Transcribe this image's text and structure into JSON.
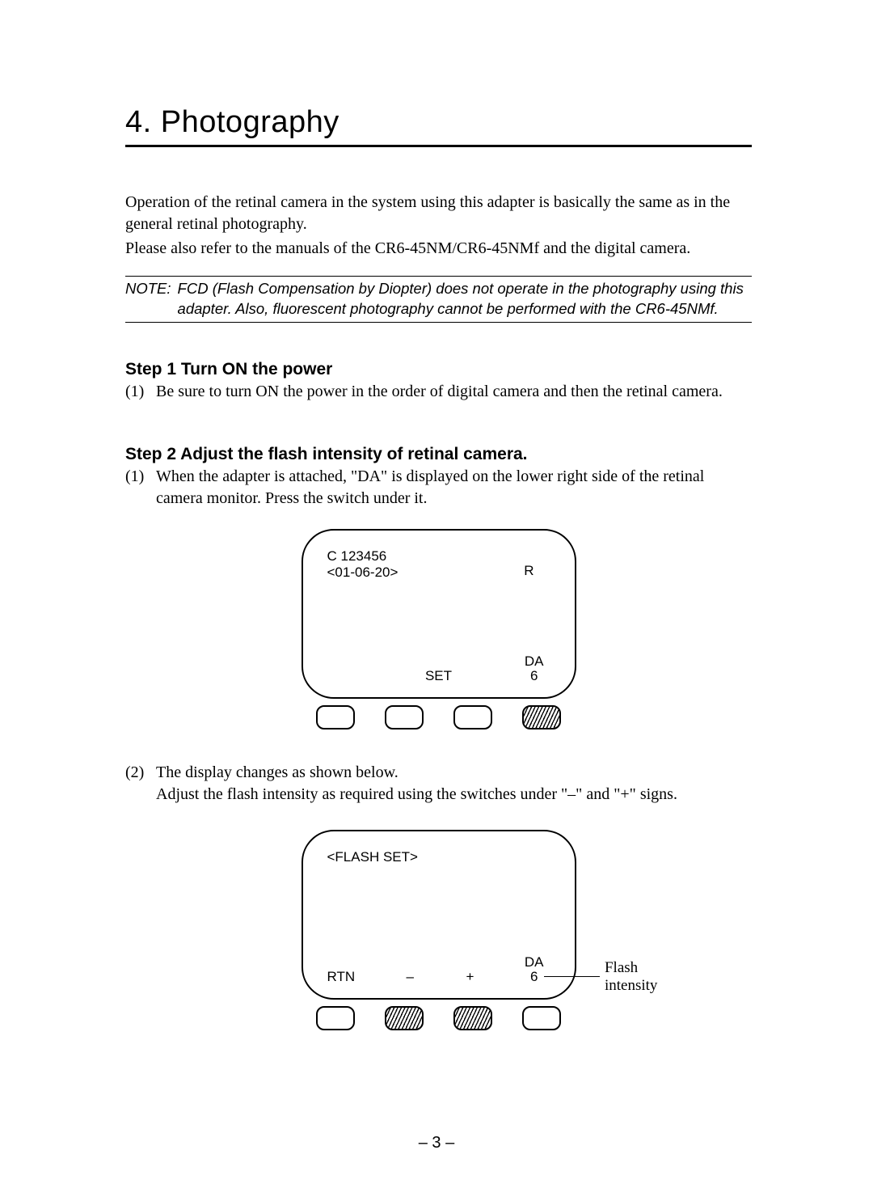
{
  "chapter": {
    "number": "4.",
    "title": "Photography"
  },
  "intro": {
    "p1": "Operation of the retinal camera in the system using this adapter is basically the same as in the general retinal photography.",
    "p2": "Please also refer to the manuals of the CR6-45NM/CR6-45NMf and the digital camera."
  },
  "note": {
    "label": "NOTE:",
    "text": "FCD (Flash Compensation by Diopter) does not operate in the photography using this adapter. Also, fluorescent photography cannot be performed with the CR6-45NMf."
  },
  "step1": {
    "heading": "Step 1  Turn ON the power",
    "item1_num": "(1)",
    "item1_text": "Be sure to turn ON the power in the order of digital camera and then the retinal camera."
  },
  "step2": {
    "heading": "Step 2  Adjust the flash intensity of retinal camera.",
    "item1_num": "(1)",
    "item1_text": "When the adapter is attached, \"DA\" is displayed on the lower right side of the retinal camera monitor. Press the switch under it.",
    "item2_num": "(2)",
    "item2_text_a": "The display changes as shown below.",
    "item2_text_b": "Adjust the flash intensity as required using the switches under \"–\" and \"+\" signs."
  },
  "monitor1": {
    "line1": "C 123456",
    "line2": "<01-06-20>",
    "right": "R",
    "set": "SET",
    "da": "DA",
    "da_val": "6"
  },
  "monitor2": {
    "title": "<FLASH SET>",
    "rtn": "RTN",
    "minus": "–",
    "plus": "+",
    "da": "DA",
    "da_val": "6",
    "callout": "Flash intensity"
  },
  "page_number": "– 3 –"
}
